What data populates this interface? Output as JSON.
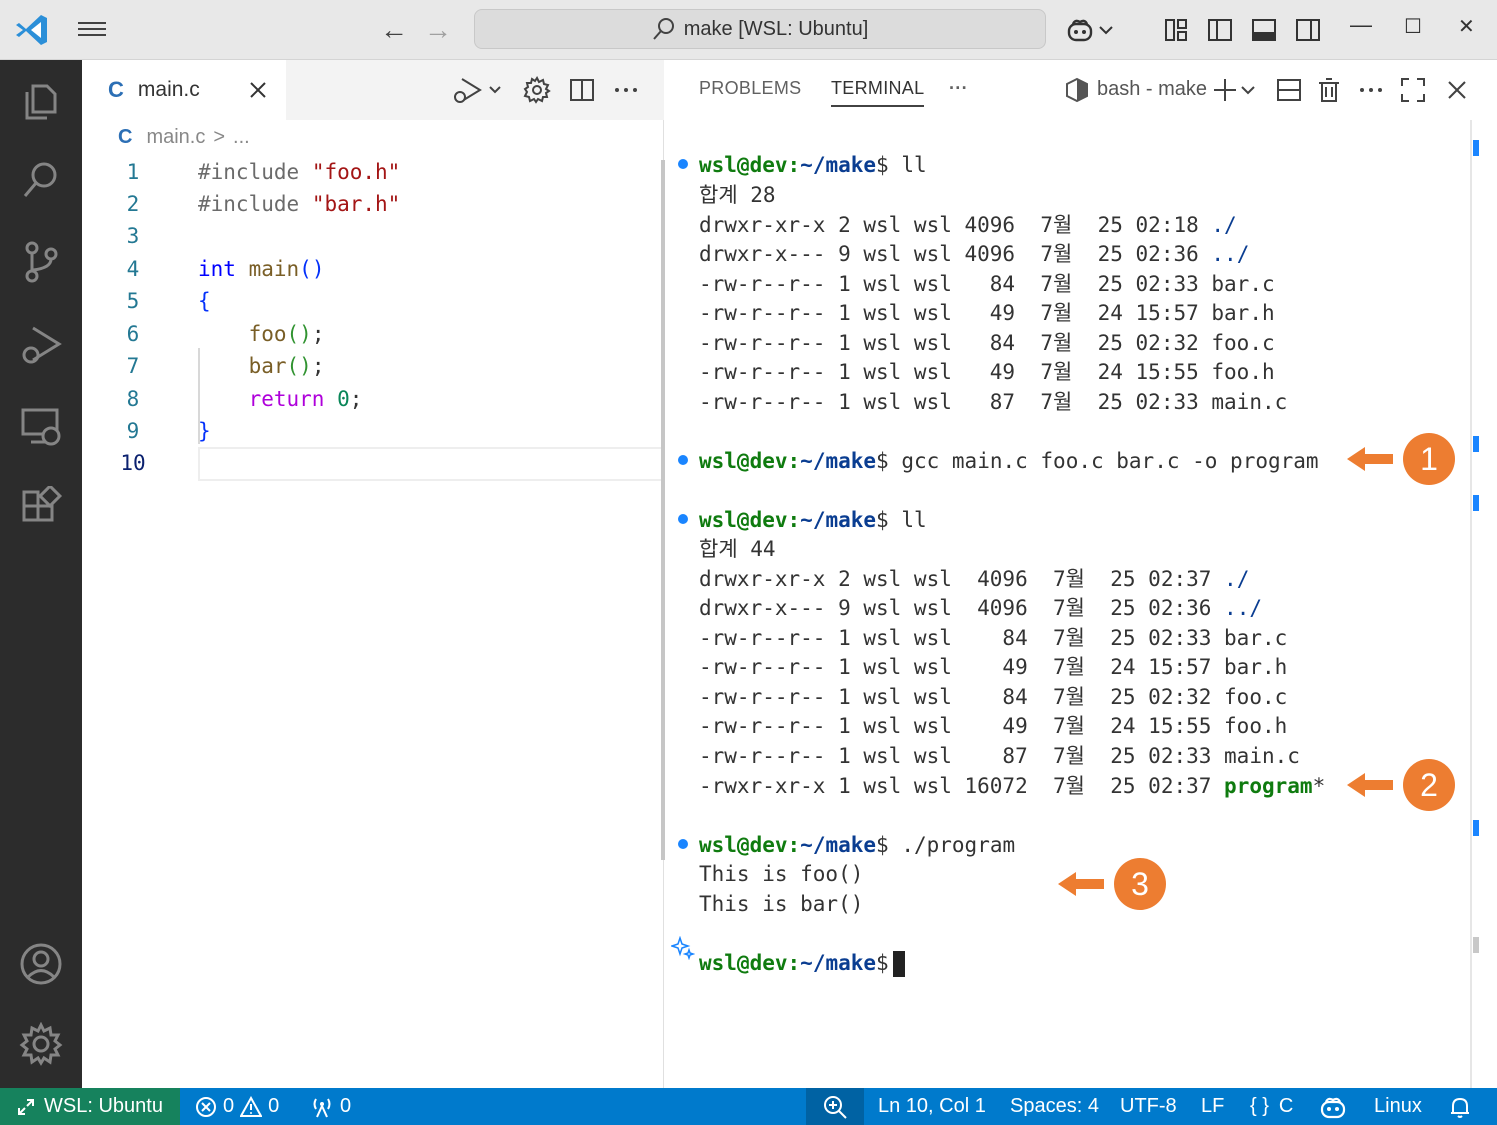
{
  "titlebar": {
    "search_text": "make [WSL: Ubuntu]",
    "back_arrow": "←",
    "forward_arrow": "→",
    "minimize": "—",
    "maximize": "☐",
    "close": "✕"
  },
  "editor": {
    "tab_icon": "C",
    "tab_label": "main.c",
    "breadcrumb_icon": "C",
    "breadcrumb_file": "main.c",
    "breadcrumb_sep": ">",
    "breadcrumb_more": "...",
    "line_numbers": [
      "1",
      "2",
      "3",
      "4",
      "5",
      "6",
      "7",
      "8",
      "9",
      "10"
    ],
    "code": {
      "l1_directive": "#include",
      "l1_string": "\"foo.h\"",
      "l2_directive": "#include",
      "l2_string": "\"bar.h\"",
      "l4_type": "int",
      "l4_fn": "main",
      "l4_paren": "()",
      "l5_brace": "{",
      "l6_fn": "foo",
      "l6_paren": "()",
      "l6_semi": ";",
      "l7_fn": "bar",
      "l7_paren": "()",
      "l7_semi": ";",
      "l8_kw": "return",
      "l8_num": "0",
      "l8_semi": ";",
      "l9_brace": "}"
    }
  },
  "panel": {
    "tab_problems": "PROBLEMS",
    "tab_terminal": "TERMINAL",
    "tab_more": "···",
    "terminal_name": "bash - make"
  },
  "terminal": {
    "prompt_user": "wsl@dev",
    "prompt_colon": ":",
    "prompt_path": "~/make",
    "prompt_dollar": "$",
    "cmd1": " ll",
    "block1": [
      {
        "text": "합계 28",
        "name": ""
      },
      {
        "text": "drwxr-xr-x 2 wsl wsl 4096  7월  25 02:18 ",
        "name": "./"
      },
      {
        "text": "drwxr-x--- 9 wsl wsl 4096  7월  25 02:36 ",
        "name": "../"
      },
      {
        "text": "-rw-r--r-- 1 wsl wsl   84  7월  25 02:33 bar.c",
        "name": ""
      },
      {
        "text": "-rw-r--r-- 1 wsl wsl   49  7월  24 15:57 bar.h",
        "name": ""
      },
      {
        "text": "-rw-r--r-- 1 wsl wsl   84  7월  25 02:32 foo.c",
        "name": ""
      },
      {
        "text": "-rw-r--r-- 1 wsl wsl   49  7월  24 15:55 foo.h",
        "name": ""
      },
      {
        "text": "-rw-r--r-- 1 wsl wsl   87  7월  25 02:33 main.c",
        "name": ""
      }
    ],
    "cmd2": " gcc main.c foo.c bar.c -o program",
    "cmd3": " ll",
    "block2": [
      {
        "text": "합계 44",
        "name": ""
      },
      {
        "text": "drwxr-xr-x 2 wsl wsl  4096  7월  25 02:37 ",
        "name": "./"
      },
      {
        "text": "drwxr-x--- 9 wsl wsl  4096  7월  25 02:36 ",
        "name": "../"
      },
      {
        "text": "-rw-r--r-- 1 wsl wsl    84  7월  25 02:33 bar.c",
        "name": ""
      },
      {
        "text": "-rw-r--r-- 1 wsl wsl    49  7월  24 15:57 bar.h",
        "name": ""
      },
      {
        "text": "-rw-r--r-- 1 wsl wsl    84  7월  25 02:32 foo.c",
        "name": ""
      },
      {
        "text": "-rw-r--r-- 1 wsl wsl    49  7월  24 15:55 foo.h",
        "name": ""
      },
      {
        "text": "-rw-r--r-- 1 wsl wsl    87  7월  25 02:33 main.c",
        "name": ""
      }
    ],
    "exe_line_prefix": "-rwxr-xr-x 1 wsl wsl 16072  7월  25 02:37 ",
    "exe_name": "program",
    "exe_suffix": "*",
    "cmd4": " ./program",
    "output1": "This is foo()",
    "output2": "This is bar()"
  },
  "annotations": {
    "a1": "1",
    "a2": "2",
    "a3": "3",
    "color": "#ed7d31"
  },
  "statusbar": {
    "remote": "WSL: Ubuntu",
    "errors": "0",
    "warnings": "0",
    "ports": "0",
    "position": "Ln 10, Col 1",
    "spaces": "Spaces: 4",
    "encoding": "UTF-8",
    "eol": "LF",
    "language_icon": "{ }",
    "language": "C",
    "os": "Linux"
  },
  "colors": {
    "accent": "#007acc",
    "remote": "#16825d",
    "activity_bar": "#2c2c2c",
    "prompt_green": "#0f7b0f",
    "prompt_blue": "#0a3d91"
  }
}
